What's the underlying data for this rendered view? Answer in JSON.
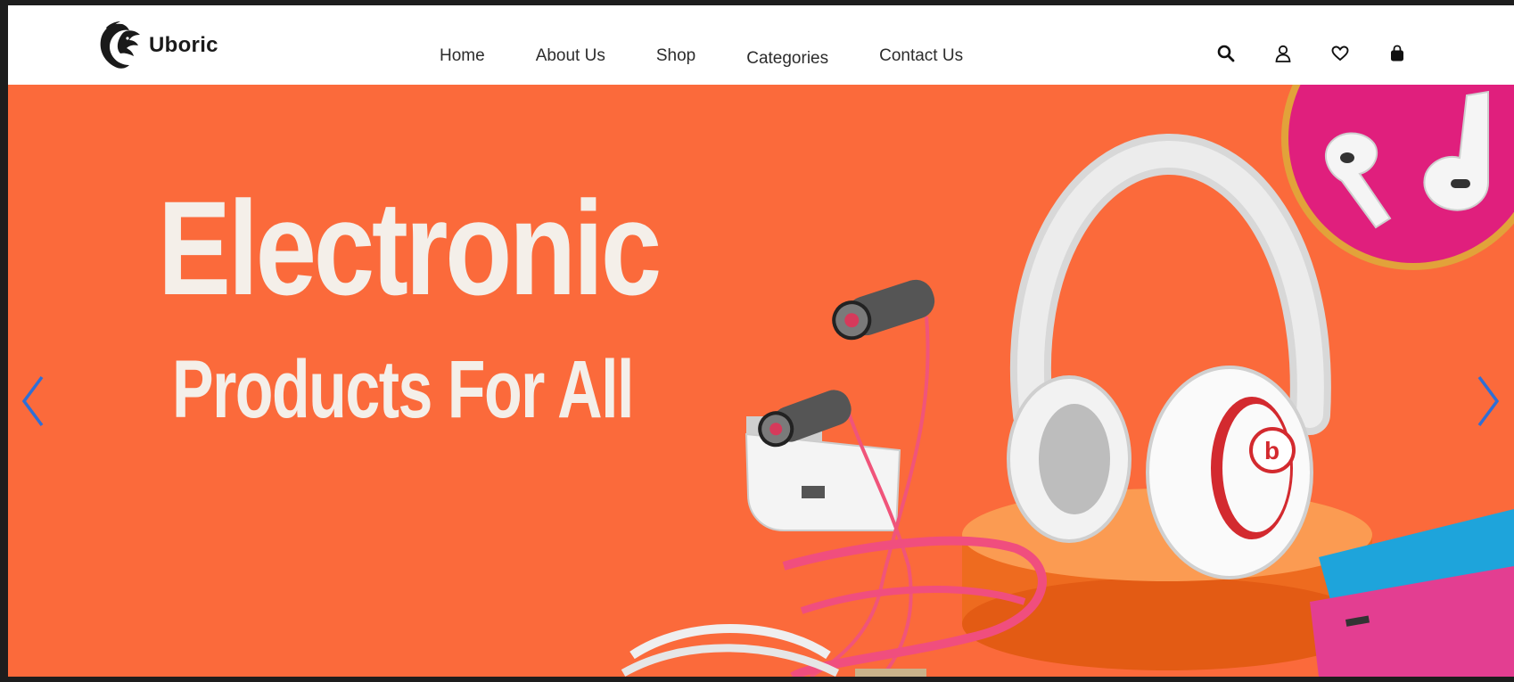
{
  "header": {
    "brand": "Uboric",
    "nav": [
      {
        "label": "Home"
      },
      {
        "label": "About Us"
      },
      {
        "label": "Shop"
      },
      {
        "label": "Categories"
      },
      {
        "label": "Contact Us"
      }
    ],
    "icons": [
      "search-icon",
      "user-icon",
      "heart-icon",
      "shopping-bag-icon"
    ]
  },
  "hero": {
    "title": "Electronic",
    "subtitle": "Products For All",
    "background_color": "#fb6a3b",
    "text_color": "#f4efe9",
    "arrow_color": "#2f6fd6",
    "slider_controls": [
      "chevron-left-icon",
      "chevron-right-icon"
    ]
  }
}
